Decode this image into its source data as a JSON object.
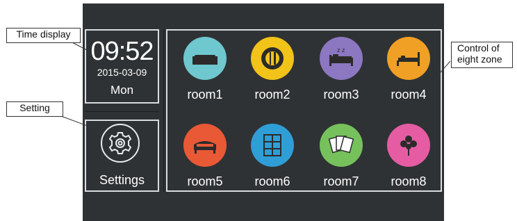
{
  "time": {
    "clock": "09:52",
    "date": "2015-03-09",
    "day": "Mon"
  },
  "settings": {
    "label": "Settings",
    "icon": "gear-icon"
  },
  "rooms": [
    {
      "label": "room1",
      "icon": "sofa-icon",
      "color": "#6fc7cf"
    },
    {
      "label": "room2",
      "icon": "dining-icon",
      "color": "#f2c318"
    },
    {
      "label": "room3",
      "icon": "sleeping-bed-icon",
      "color": "#8c77c1"
    },
    {
      "label": "room4",
      "icon": "bed-icon",
      "color": "#f0a024"
    },
    {
      "label": "room5",
      "icon": "sofa-bed-icon",
      "color": "#ea5936"
    },
    {
      "label": "room6",
      "icon": "bookshelf-icon",
      "color": "#2f9ed7"
    },
    {
      "label": "room7",
      "icon": "playing-cards-icon",
      "color": "#76c15c"
    },
    {
      "label": "room8",
      "icon": "flower-icon",
      "color": "#e55ca3"
    }
  ],
  "callouts": {
    "time_display": "Time display",
    "setting": "Setting",
    "control_line1": "Control of",
    "control_line2": "eight zone"
  }
}
